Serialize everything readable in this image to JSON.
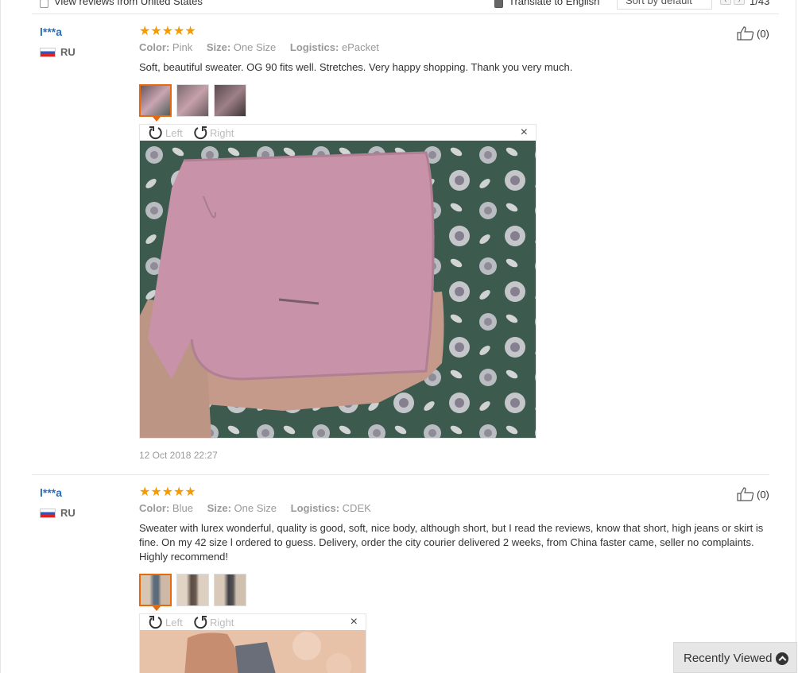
{
  "filter_bar": {
    "view_us_label": "View reviews from United States",
    "translate_label": "Translate to English",
    "sort_value": "Sort by default",
    "page": "1/43"
  },
  "reviews": [
    {
      "user": "l***a",
      "country": "RU",
      "rating": "★★★★★",
      "color_label": "Color:",
      "color": "Pink",
      "size_label": "Size:",
      "size": "One Size",
      "logistics_label": "Logistics:",
      "logistics": "ePacket",
      "helpful": "(0)",
      "text": "Soft, beautiful sweater. OG 90 fits well. Stretches. Very happy shopping. Thank you very much.",
      "date": "12 Oct 2018 22:27",
      "viewer": {
        "rotate_left": "Left",
        "rotate_right": "Right",
        "close": "×"
      }
    },
    {
      "user": "l***a",
      "country": "RU",
      "rating": "★★★★★",
      "color_label": "Color:",
      "color": "Blue",
      "size_label": "Size:",
      "size": "One Size",
      "logistics_label": "Logistics:",
      "logistics": "CDEK",
      "helpful": "(0)",
      "text": "Sweater with lurex wonderful, quality is good, soft, nice body, although short, but I read the reviews, know that short, high jeans or skirt is fine. On my 42 size l ordered to guess. Delivery, order the city courier delivered 2 weeks, from China faster came, seller no complaints. Highly recommend!",
      "viewer": {
        "rotate_left": "Left",
        "rotate_right": "Right",
        "close": "×"
      }
    }
  ],
  "recently_viewed": "Recently Viewed",
  "colors": {
    "link_blue": "#2a6ebb",
    "star_orange": "#f59a00",
    "active_thumb": "#e8690c"
  }
}
